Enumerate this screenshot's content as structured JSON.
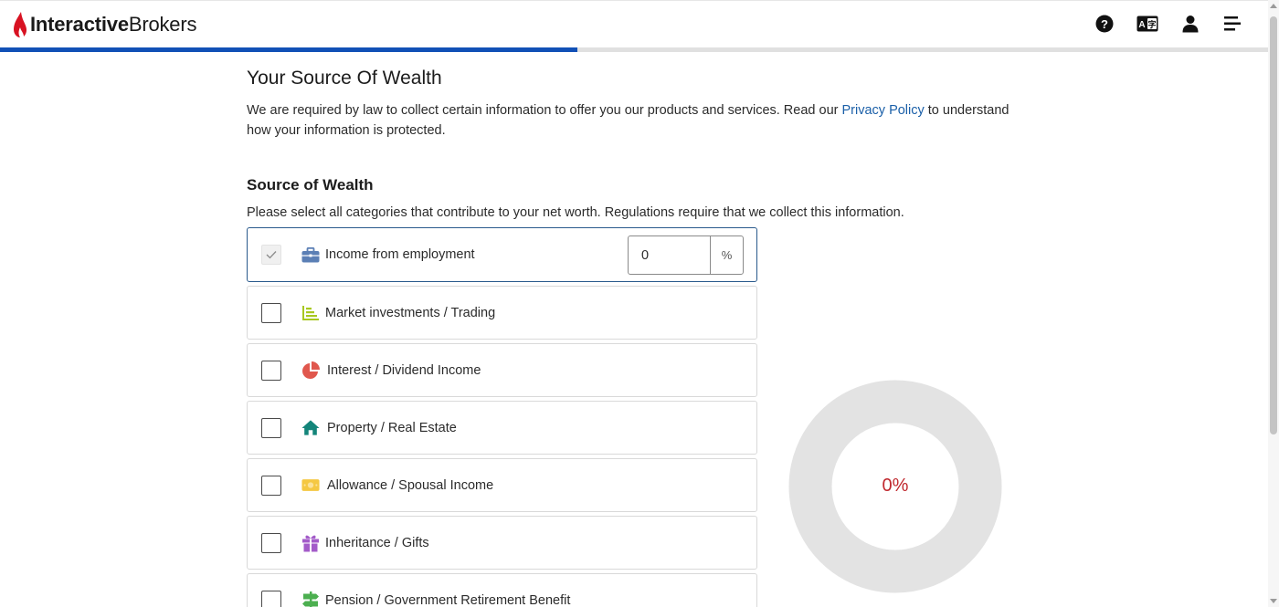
{
  "header": {
    "logo_bold": "Interactive",
    "logo_regular": "Brokers",
    "icons": [
      "help-icon",
      "language-icon",
      "user-icon",
      "menu-icon"
    ],
    "brand_color": "#d81222"
  },
  "progress": {
    "fraction": 0.455,
    "color": "#1150b6"
  },
  "page": {
    "title": "Your Source Of Wealth",
    "intro_before": "We are required by law to collect certain information to offer you our products and services. Read our ",
    "intro_link": "Privacy Policy",
    "intro_after": " to understand how your information is protected.",
    "section_title": "Source of Wealth",
    "section_sub": "Please select all categories that contribute to your net worth. Regulations require that we collect this information."
  },
  "options": [
    {
      "label": "Income from employment",
      "icon": "briefcase-icon",
      "icon_color": "#5b7fb5",
      "checked": true,
      "percent_value": "0",
      "percent_sign": "%"
    },
    {
      "label": "Market investments / Trading",
      "icon": "bar-chart-icon",
      "icon_color": "#a8c820",
      "checked": false
    },
    {
      "label": "Interest / Dividend Income",
      "icon": "pie-chart-icon",
      "icon_color": "#e0574d",
      "checked": false
    },
    {
      "label": "Property / Real Estate",
      "icon": "house-icon",
      "icon_color": "#14857a",
      "checked": false
    },
    {
      "label": "Allowance / Spousal Income",
      "icon": "banknote-icon",
      "icon_color": "#f5c842",
      "checked": false
    },
    {
      "label": "Inheritance / Gifts",
      "icon": "gift-icon",
      "icon_color": "#a35bc9",
      "checked": false
    },
    {
      "label": "Pension / Government Retirement Benefit",
      "icon": "signpost-icon",
      "icon_color": "#4caf50",
      "checked": false
    }
  ],
  "donut": {
    "label": "0%",
    "percent": 0,
    "track_color": "#e3e3e3",
    "label_color": "#c0282e"
  }
}
